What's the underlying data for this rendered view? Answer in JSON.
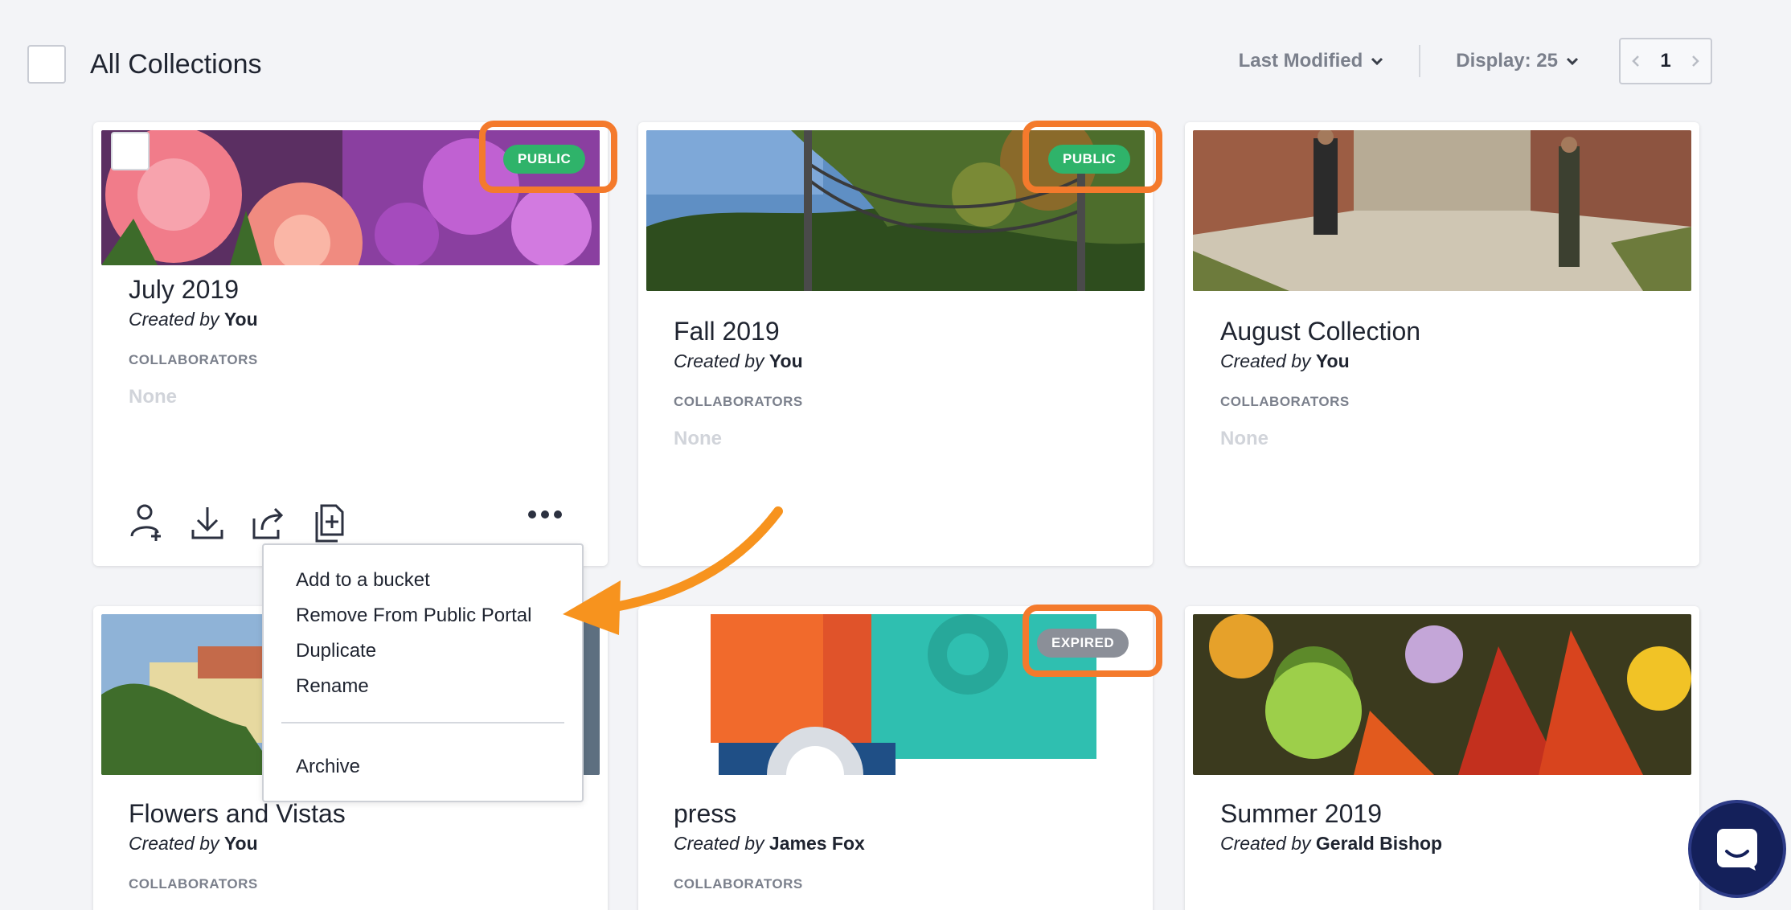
{
  "header": {
    "title": "All Collections",
    "sort_label": "Last Modified",
    "display_label": "Display: 25",
    "page_number": "1"
  },
  "cards": [
    {
      "title": "July 2019",
      "created_prefix": "Created by",
      "creator": "You",
      "collab_label": "COLLABORATORS",
      "collab_value": "None",
      "badge": "PUBLIC"
    },
    {
      "title": "Fall 2019",
      "created_prefix": "Created by",
      "creator": "You",
      "collab_label": "COLLABORATORS",
      "collab_value": "None",
      "badge": "PUBLIC"
    },
    {
      "title": "August Collection",
      "created_prefix": "Created by",
      "creator": "You",
      "collab_label": "COLLABORATORS",
      "collab_value": "None"
    },
    {
      "title": "Flowers and Vistas",
      "created_prefix": "Created by",
      "creator": "You",
      "collab_label": "COLLABORATORS"
    },
    {
      "title": "press",
      "created_prefix": "Created by",
      "creator": "James Fox",
      "collab_label": "COLLABORATORS",
      "badge": "EXPIRED"
    },
    {
      "title": "Summer 2019",
      "created_prefix": "Created by",
      "creator": "Gerald Bishop"
    }
  ],
  "menu": {
    "items": [
      "Add to a bucket",
      "Remove From Public Portal",
      "Duplicate",
      "Rename"
    ],
    "archive": "Archive"
  },
  "icons": {
    "card_actions": [
      "add-collaborator-icon",
      "download-icon",
      "share-icon",
      "duplicate-icon"
    ],
    "more": "more-dots-icon",
    "chat": "chat-icon"
  },
  "colors": {
    "public_badge": "#2fb36a",
    "expired_badge": "#8b8f98",
    "highlight": "#f47a2c",
    "arrow": "#f7931e",
    "chat_bubble": "#14205a"
  }
}
